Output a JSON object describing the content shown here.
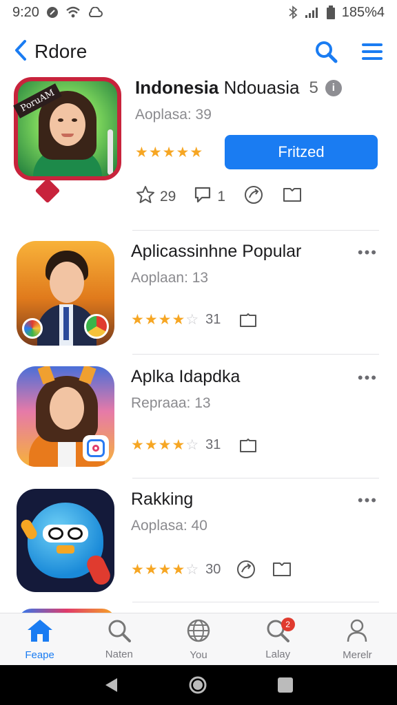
{
  "status_bar": {
    "time": "9:20",
    "battery": "185%4"
  },
  "header": {
    "back_label": "Rdore"
  },
  "featured": {
    "banner": "PoruAM",
    "title_bold": "Indonesia",
    "title_rest": "Ndouasia",
    "title_num": "5",
    "info": "i",
    "subtitle": "Aoplasa: 39",
    "rating_full": 5,
    "button_label": "Fritzed",
    "actions": [
      {
        "icon": "star-outline-icon",
        "count": "29"
      },
      {
        "icon": "comment-icon",
        "count": "1"
      },
      {
        "icon": "share-icon",
        "count": ""
      },
      {
        "icon": "bookmark-icon",
        "count": ""
      }
    ]
  },
  "apps": [
    {
      "title": "Aplicassinhne Popular",
      "subtitle": "Aoplaan: 13",
      "rating_full": 4,
      "count": "31",
      "extra_icons": []
    },
    {
      "title": "Aplka Idapdka",
      "subtitle": "Repraaa: 13",
      "rating_full": 4,
      "count": "31",
      "extra_icons": []
    },
    {
      "title": "Rakking",
      "subtitle": "Aoplasa: 40",
      "rating_full": 4,
      "count": "30",
      "extra_icons": [
        "share-icon"
      ]
    }
  ],
  "more_label": "•••",
  "bottom_nav": {
    "items": [
      {
        "label": "Feape",
        "icon": "home-icon",
        "active": true
      },
      {
        "label": "Naten",
        "icon": "search-icon",
        "active": false
      },
      {
        "label": "You",
        "icon": "globe-icon",
        "active": false
      },
      {
        "label": "Lalay",
        "icon": "search-badge-icon",
        "active": false,
        "badge": "2"
      },
      {
        "label": "Merelr",
        "icon": "profile-icon",
        "active": false
      }
    ]
  },
  "colors": {
    "accent": "#1a7cf2",
    "star": "#f6a623",
    "badge": "#e03b2f",
    "featured_border": "#c8233c"
  }
}
